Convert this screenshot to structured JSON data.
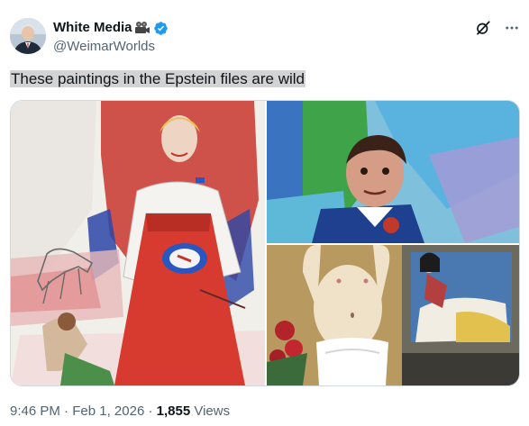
{
  "author": {
    "display_name": "White Media",
    "handle": "@WeimarWorlds",
    "avatar_icon": "avatar-portrait-icon",
    "emoji_icon": "movie-camera-icon",
    "verified_icon": "verified-badge-icon"
  },
  "actions": {
    "grok_icon": "grok-icon",
    "more_icon": "more-icon"
  },
  "tweet": {
    "text": "These paintings in the Epstein files are wild"
  },
  "media": {
    "images": [
      {
        "subject": "woman-in-red-skirt-painting"
      },
      {
        "subject": "man-portrait-painting"
      },
      {
        "subject": "figure-and-bed-painting"
      }
    ]
  },
  "meta": {
    "time": "9:46 PM",
    "separator": "·",
    "date": "Feb 1, 2026",
    "views_count": "1,855",
    "views_label": "Views"
  },
  "colors": {
    "verified": "#1d9bf0",
    "text_primary": "#0f1419",
    "text_secondary": "#536471",
    "highlight": "#d3d3d3"
  }
}
